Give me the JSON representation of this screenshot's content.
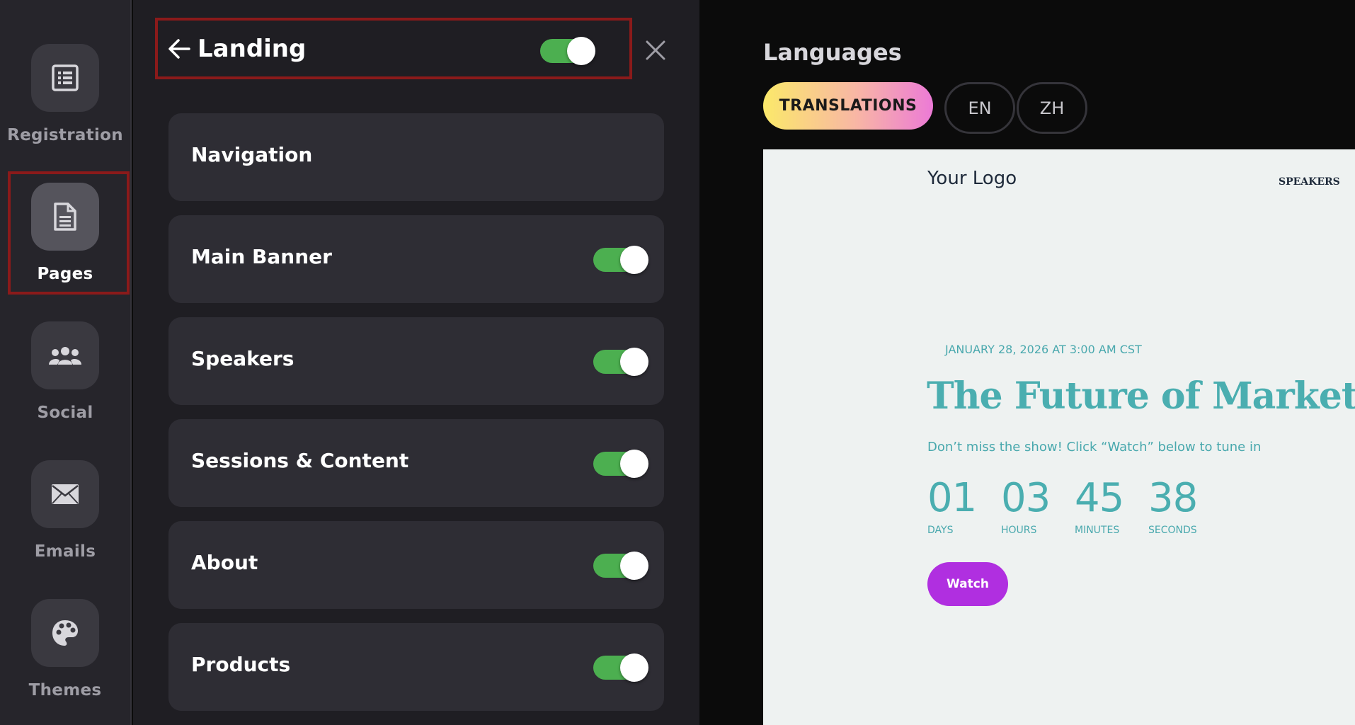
{
  "rail": {
    "items": [
      {
        "label": "Registration",
        "icon": "list-icon"
      },
      {
        "label": "Pages",
        "icon": "document-icon",
        "active": true
      },
      {
        "label": "Social",
        "icon": "users-icon"
      },
      {
        "label": "Emails",
        "icon": "envelope-icon"
      },
      {
        "label": "Themes",
        "icon": "palette-icon"
      }
    ]
  },
  "panel": {
    "title": "Landing",
    "title_toggle_on": true,
    "sections": [
      {
        "label": "Navigation",
        "has_toggle": false
      },
      {
        "label": "Main Banner",
        "has_toggle": true,
        "on": true
      },
      {
        "label": "Speakers",
        "has_toggle": true,
        "on": true
      },
      {
        "label": "Sessions & Content",
        "has_toggle": true,
        "on": true
      },
      {
        "label": "About",
        "has_toggle": true,
        "on": true
      },
      {
        "label": "Products",
        "has_toggle": true,
        "on": true
      }
    ]
  },
  "languages": {
    "title": "Languages",
    "translations_label": "TRANSLATIONS",
    "options": [
      "EN",
      "ZH"
    ]
  },
  "preview": {
    "logo": "Your Logo",
    "nav_link": "SPEAKERS",
    "date": "JANUARY 28, 2026 AT 3:00 AM CST",
    "title": "The Future of Marketing",
    "subtitle": "Don’t miss the show! Click “Watch” below to tune in",
    "countdown": [
      {
        "value": "01",
        "unit": "DAYS"
      },
      {
        "value": "03",
        "unit": "HOURS"
      },
      {
        "value": "45",
        "unit": "MINUTES"
      },
      {
        "value": "38",
        "unit": "SECONDS"
      }
    ],
    "watch_label": "Watch"
  },
  "colors": {
    "toggle_on": "#4caf50",
    "highlight_border": "#8b1a1a",
    "accent_teal": "#4aaeb0",
    "watch_button": "#b02fe0"
  }
}
